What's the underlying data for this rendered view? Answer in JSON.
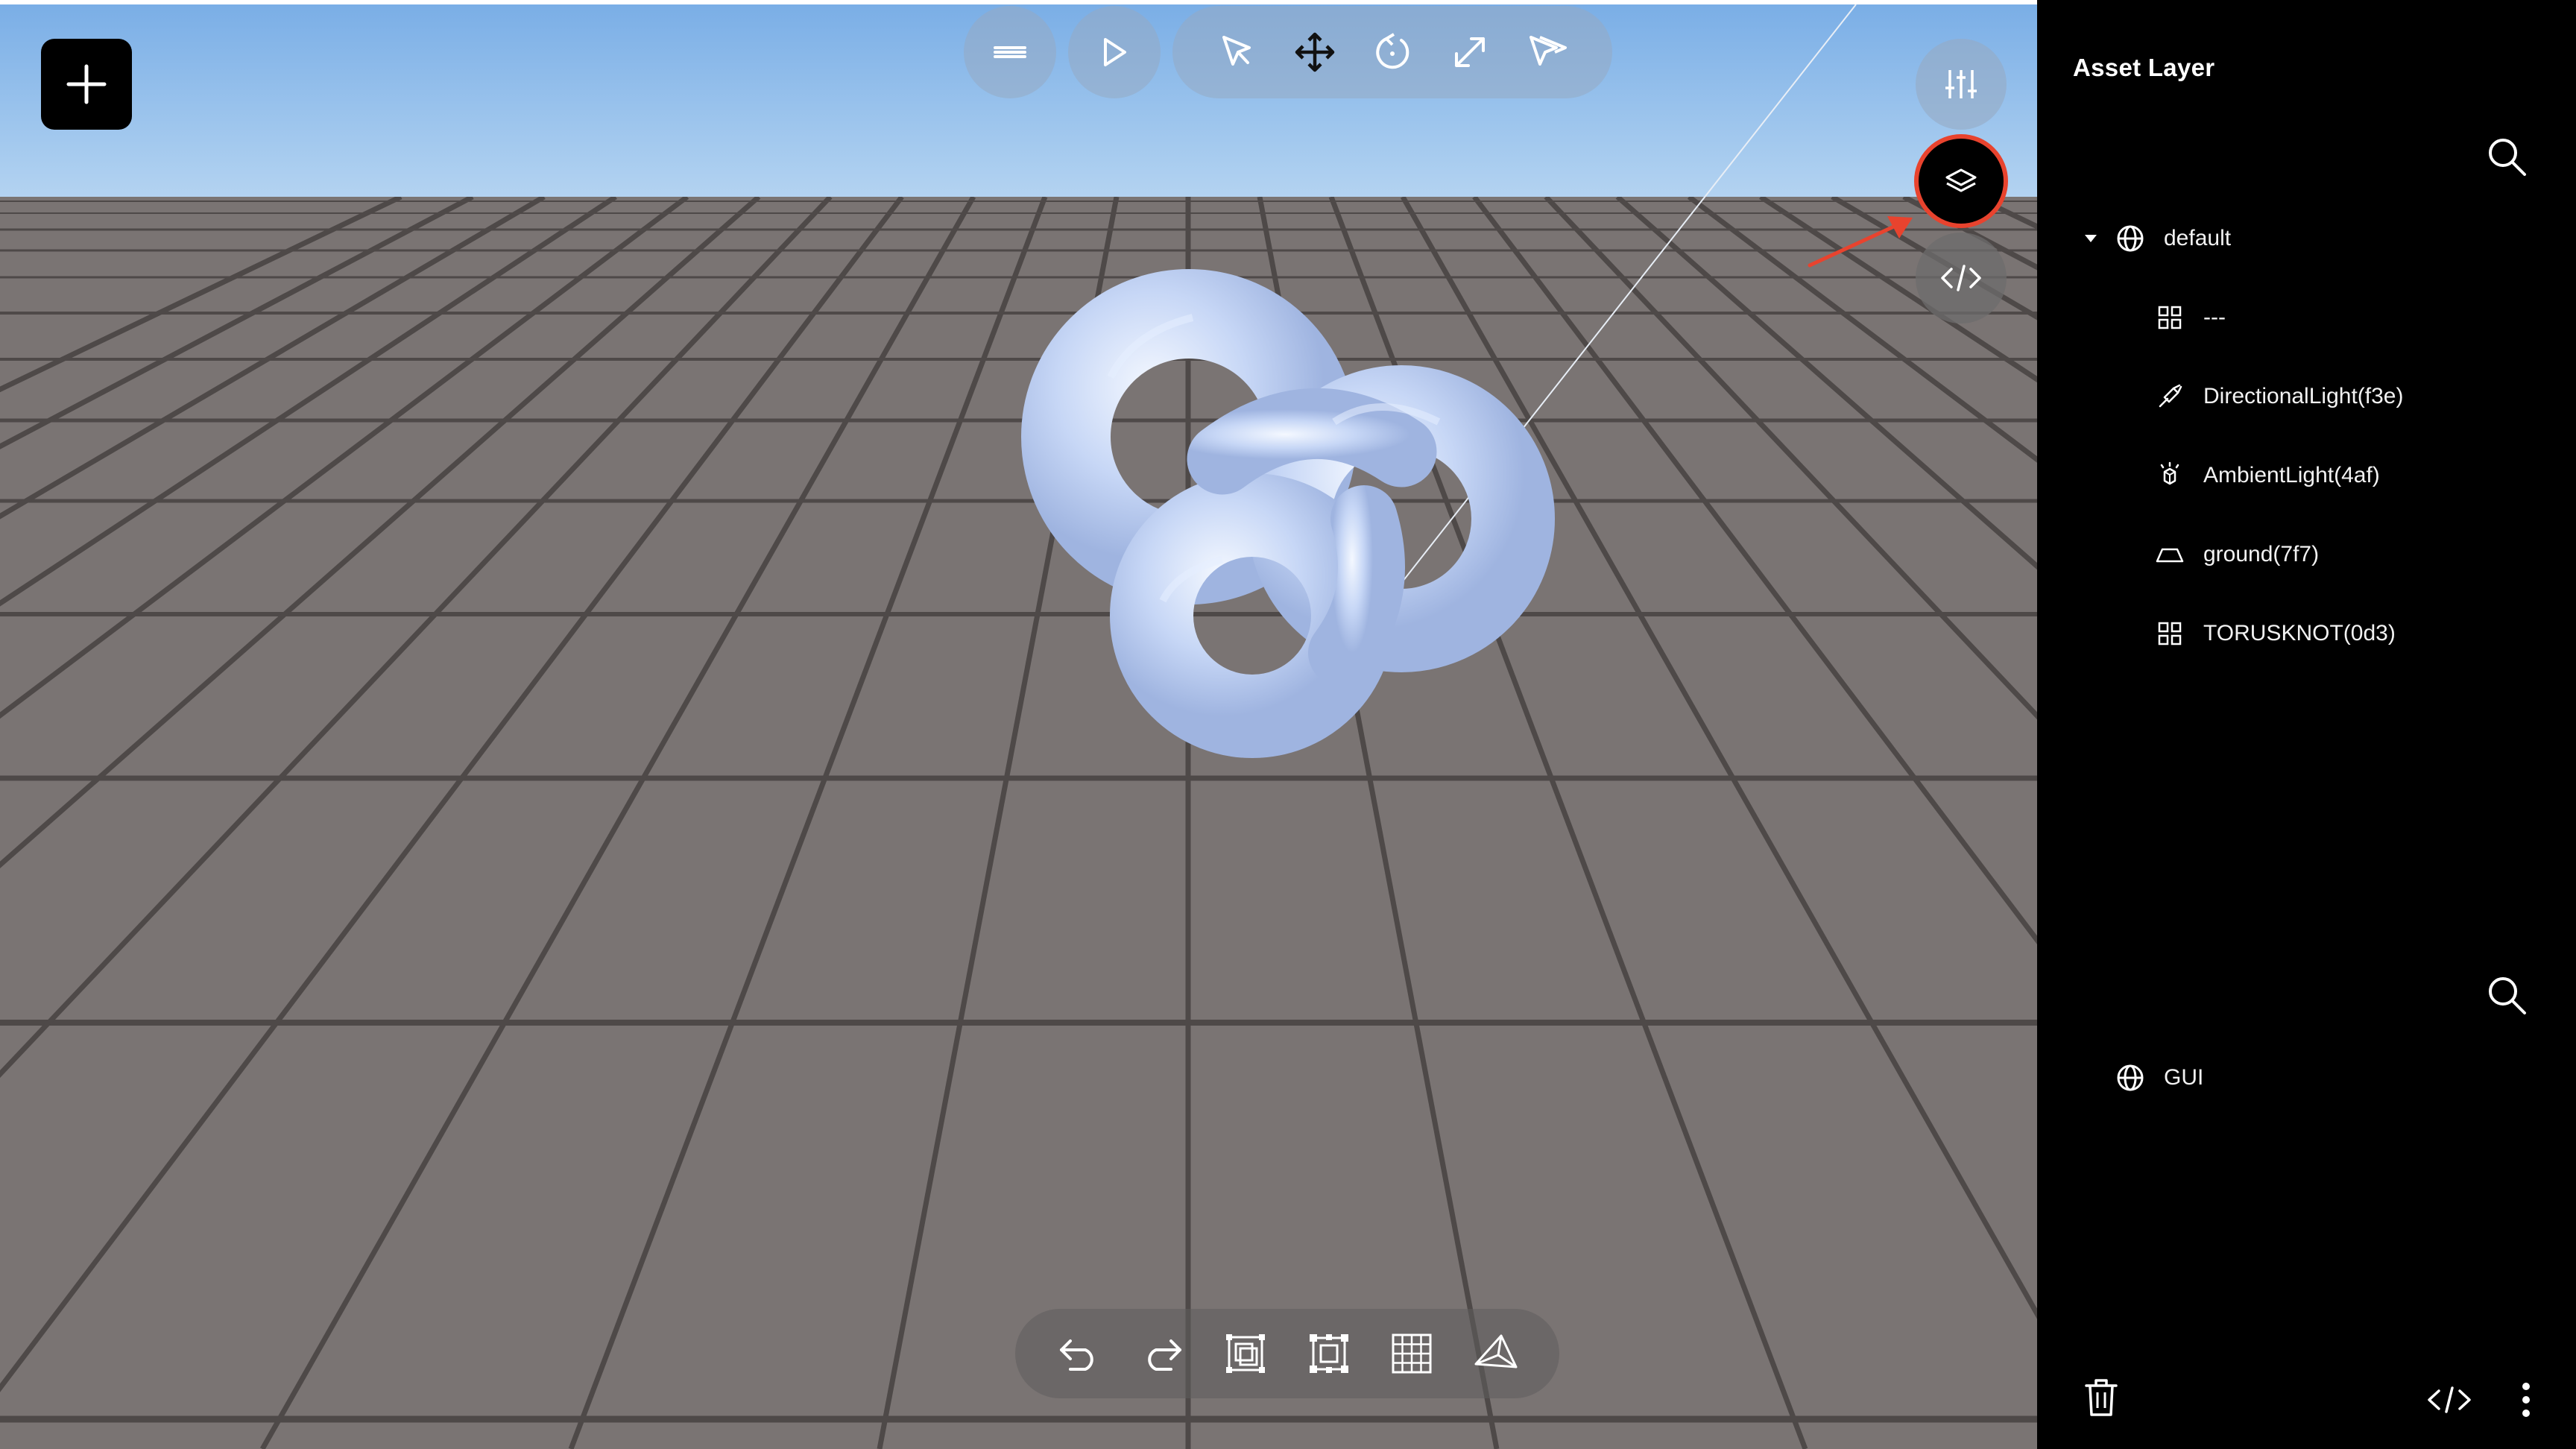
{
  "panel": {
    "title": "Asset Layer",
    "tree": {
      "root": {
        "label": "default",
        "icon": "globe-icon",
        "expanded": true
      },
      "children": [
        {
          "label": "---",
          "icon": "grid-icon"
        },
        {
          "label": "DirectionalLight(f3e)",
          "icon": "directional-light-icon"
        },
        {
          "label": "AmbientLight(4af)",
          "icon": "ambient-light-icon"
        },
        {
          "label": "ground(7f7)",
          "icon": "ground-plane-icon"
        },
        {
          "label": "TORUSKNOT(0d3)",
          "icon": "grid-icon"
        }
      ]
    },
    "gui_tree": {
      "root": {
        "label": "GUI",
        "icon": "globe-icon"
      }
    },
    "footer": [
      "trash-icon",
      "code-icon",
      "more-vertical-icon"
    ]
  },
  "toolbar": {
    "menu": "menu-icon",
    "play": "play-icon",
    "tools": [
      "select-pointer-icon",
      "move-icon",
      "rotate-icon",
      "scale-icon",
      "multi-select-pointer-icon"
    ]
  },
  "side_controls": [
    "settings-sliders-icon",
    "layers-icon",
    "code-icon"
  ],
  "bottom_toolbar": [
    "undo-icon",
    "redo-icon",
    "duplicate-icon",
    "bounding-box-icon",
    "grid-toggle-icon",
    "camera-icon"
  ],
  "scene": {
    "object": "torus knot",
    "object_color": "#c2d3f5",
    "floor_color": "#7a7473",
    "sky_color": "#8fbcec"
  },
  "annotation": {
    "highlight_color": "#e8432e"
  }
}
